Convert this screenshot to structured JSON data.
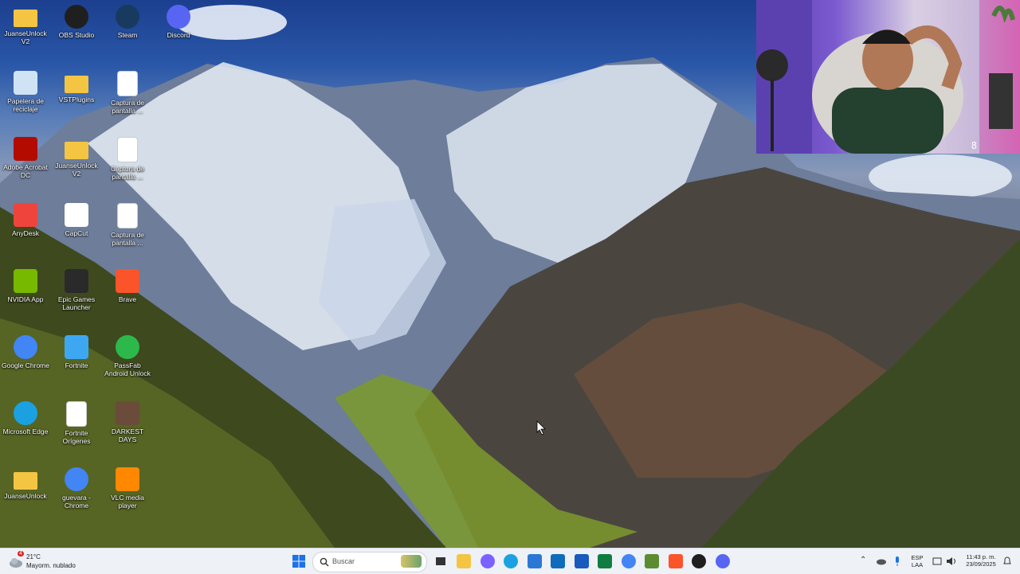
{
  "desktop_icons": [
    {
      "label": "JuanseUnlock V2",
      "icon": "folder-icon",
      "color": "#f4c542"
    },
    {
      "label": "OBS Studio",
      "icon": "obs-icon",
      "color": "#1f1f1f"
    },
    {
      "label": "Steam",
      "icon": "steam-icon",
      "color": "#173a5e"
    },
    {
      "label": "Discord",
      "icon": "discord-icon",
      "color": "#5865f2"
    },
    {
      "label": "Papelera de reciclaje",
      "icon": "recycle-bin-icon",
      "color": "#cfe3f5"
    },
    {
      "label": "VSTPlugins",
      "icon": "folder-icon",
      "color": "#f4c542"
    },
    {
      "label": "Captura de pantalla ...",
      "icon": "screenshot-file-icon",
      "color": "#ffffff"
    },
    {
      "label": "Adobe Acrobat DC",
      "icon": "acrobat-icon",
      "color": "#b30b00"
    },
    {
      "label": "JuanseUnlock V2",
      "icon": "folder-icon",
      "color": "#f4c542"
    },
    {
      "label": "Captura de pantalla ...",
      "icon": "screenshot-file-icon",
      "color": "#ffffff"
    },
    {
      "label": "AnyDesk",
      "icon": "anydesk-icon",
      "color": "#ef443b"
    },
    {
      "label": "CapCut",
      "icon": "capcut-icon",
      "color": "#ffffff"
    },
    {
      "label": "Captura de pantalla ...",
      "icon": "screenshot-file-icon",
      "color": "#ffffff"
    },
    {
      "label": "NVIDIA App",
      "icon": "nvidia-icon",
      "color": "#76b900"
    },
    {
      "label": "Epic Games Launcher",
      "icon": "epic-games-icon",
      "color": "#2a2a2a"
    },
    {
      "label": "Brave",
      "icon": "brave-icon",
      "color": "#fb542b"
    },
    {
      "label": "Google Chrome",
      "icon": "chrome-icon",
      "color": "#4285f4"
    },
    {
      "label": "Fortnite",
      "icon": "fortnite-icon",
      "color": "#3ea7f2"
    },
    {
      "label": "PassFab Android Unlock",
      "icon": "passfab-icon",
      "color": "#2db84b"
    },
    {
      "label": "Microsoft Edge",
      "icon": "edge-icon",
      "color": "#1ba1e2"
    },
    {
      "label": "Fortnite Orígenes",
      "icon": "file-icon",
      "color": "#ffffff"
    },
    {
      "label": "DARKEST DAYS",
      "icon": "darkest-days-icon",
      "color": "#6b4c3b"
    },
    {
      "label": "JuanseUnlock",
      "icon": "folder-icon",
      "color": "#f4c542"
    },
    {
      "label": "guevara - Chrome",
      "icon": "chrome-icon",
      "color": "#4285f4"
    },
    {
      "label": "VLC media player",
      "icon": "vlc-icon",
      "color": "#ff8800"
    }
  ],
  "taskbar": {
    "weather_temp": "21°C",
    "weather_desc": "Mayorm. nublado",
    "weather_badge": "4",
    "search_placeholder": "Buscar",
    "lang_top": "ESP",
    "lang_bottom": "LAA",
    "time": "11:43 p. m.",
    "date": "23/09/2025",
    "pinned": [
      {
        "icon": "file-explorer-icon",
        "color": "#f4c542"
      },
      {
        "icon": "copilot-icon",
        "color": "#7b61ff"
      },
      {
        "icon": "edge-icon",
        "color": "#1ba1e2"
      },
      {
        "icon": "store-icon",
        "color": "#2b78d4"
      },
      {
        "icon": "outlook-icon",
        "color": "#0f6cbd"
      },
      {
        "icon": "word-icon",
        "color": "#185abd"
      },
      {
        "icon": "excel-icon",
        "color": "#107c41"
      },
      {
        "icon": "chrome-icon",
        "color": "#4285f4"
      },
      {
        "icon": "minecraft-icon",
        "color": "#5b8c32"
      },
      {
        "icon": "brave-icon",
        "color": "#fb542b"
      },
      {
        "icon": "obs-icon",
        "color": "#1f1f1f"
      },
      {
        "icon": "discord-icon",
        "color": "#5865f2"
      }
    ]
  },
  "webcam": {
    "counter": "8"
  }
}
